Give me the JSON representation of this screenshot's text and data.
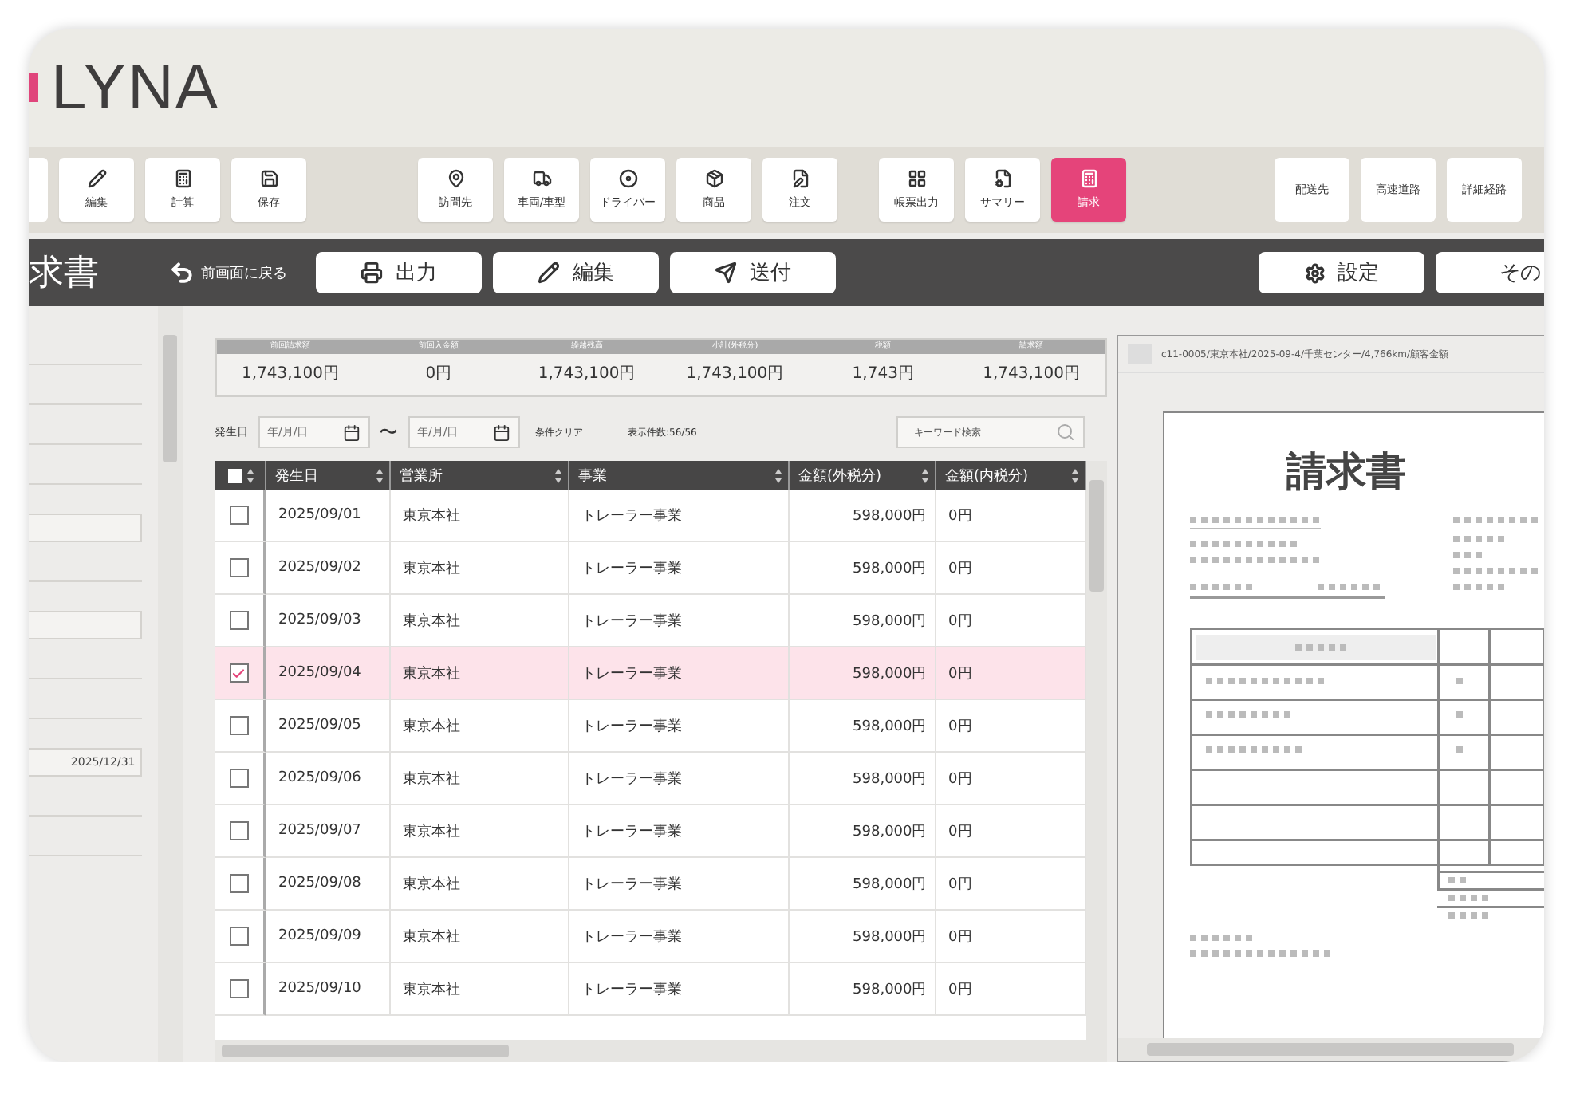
{
  "logo": "LYNA",
  "toolbar": {
    "groups": [
      [
        {
          "label": "編集",
          "selected": false
        },
        {
          "label": "計算",
          "selected": false
        },
        {
          "label": "保存",
          "selected": false
        }
      ],
      [
        {
          "label": "訪問先",
          "selected": false
        },
        {
          "label": "車両/車型",
          "selected": false
        },
        {
          "label": "ドライバー",
          "selected": false
        },
        {
          "label": "商品",
          "selected": false
        },
        {
          "label": "注文",
          "selected": false
        }
      ],
      [
        {
          "label": "帳票出力",
          "selected": false
        },
        {
          "label": "サマリー",
          "selected": false
        },
        {
          "label": "請求",
          "selected": true
        }
      ],
      [
        {
          "label": "配送先",
          "selected": false
        },
        {
          "label": "高速道路",
          "selected": false
        },
        {
          "label": "詳細経路",
          "selected": false
        }
      ]
    ]
  },
  "action_bar": {
    "title": "求書",
    "back": "前画面に戻る",
    "buttons": [
      "出力",
      "編集",
      "送付"
    ],
    "right_buttons": [
      "設定",
      "その"
    ]
  },
  "side_panel": {
    "date_to": "2025/12/31"
  },
  "summary": {
    "columns": [
      {
        "label": "前回請求額",
        "value": "1,743,100円"
      },
      {
        "label": "前回入金額",
        "value": "0円"
      },
      {
        "label": "繰越残高",
        "value": "1,743,100円"
      },
      {
        "label": "小計(外税分)",
        "value": "1,743,100円"
      },
      {
        "label": "税額",
        "value": "1,743円"
      },
      {
        "label": "請求額",
        "value": "1,743,100円"
      }
    ]
  },
  "filter": {
    "label": "発生日",
    "from_placeholder": "年/月/日",
    "separator": "〜",
    "to_placeholder": "年/月/日",
    "clear": "条件クリア",
    "count": "表示件数:56/56",
    "search_placeholder": "キーワード検索"
  },
  "table": {
    "select_all_checked": false,
    "columns": [
      "発生日",
      "営業所",
      "事業",
      "金額(外税分)",
      "金額(内税分)"
    ],
    "rows": [
      {
        "checked": false,
        "cells": [
          "2025/09/01",
          "東京本社",
          "トレーラー事業",
          "598,000円",
          "0円"
        ]
      },
      {
        "checked": false,
        "cells": [
          "2025/09/02",
          "東京本社",
          "トレーラー事業",
          "598,000円",
          "0円"
        ]
      },
      {
        "checked": false,
        "cells": [
          "2025/09/03",
          "東京本社",
          "トレーラー事業",
          "598,000円",
          "0円"
        ]
      },
      {
        "checked": true,
        "cells": [
          "2025/09/04",
          "東京本社",
          "トレーラー事業",
          "598,000円",
          "0円"
        ]
      },
      {
        "checked": false,
        "cells": [
          "2025/09/05",
          "東京本社",
          "トレーラー事業",
          "598,000円",
          "0円"
        ]
      },
      {
        "checked": false,
        "cells": [
          "2025/09/06",
          "東京本社",
          "トレーラー事業",
          "598,000円",
          "0円"
        ]
      },
      {
        "checked": false,
        "cells": [
          "2025/09/07",
          "東京本社",
          "トレーラー事業",
          "598,000円",
          "0円"
        ]
      },
      {
        "checked": false,
        "cells": [
          "2025/09/08",
          "東京本社",
          "トレーラー事業",
          "598,000円",
          "0円"
        ]
      },
      {
        "checked": false,
        "cells": [
          "2025/09/09",
          "東京本社",
          "トレーラー事業",
          "598,000円",
          "0円"
        ]
      },
      {
        "checked": false,
        "cells": [
          "2025/09/10",
          "東京本社",
          "トレーラー事業",
          "598,000円",
          "0円"
        ]
      }
    ]
  },
  "preview": {
    "path": "c11-0005/東京本社/2025-09-4/千葉センター/4,766km/顧客金額",
    "document_title": "請求書"
  }
}
